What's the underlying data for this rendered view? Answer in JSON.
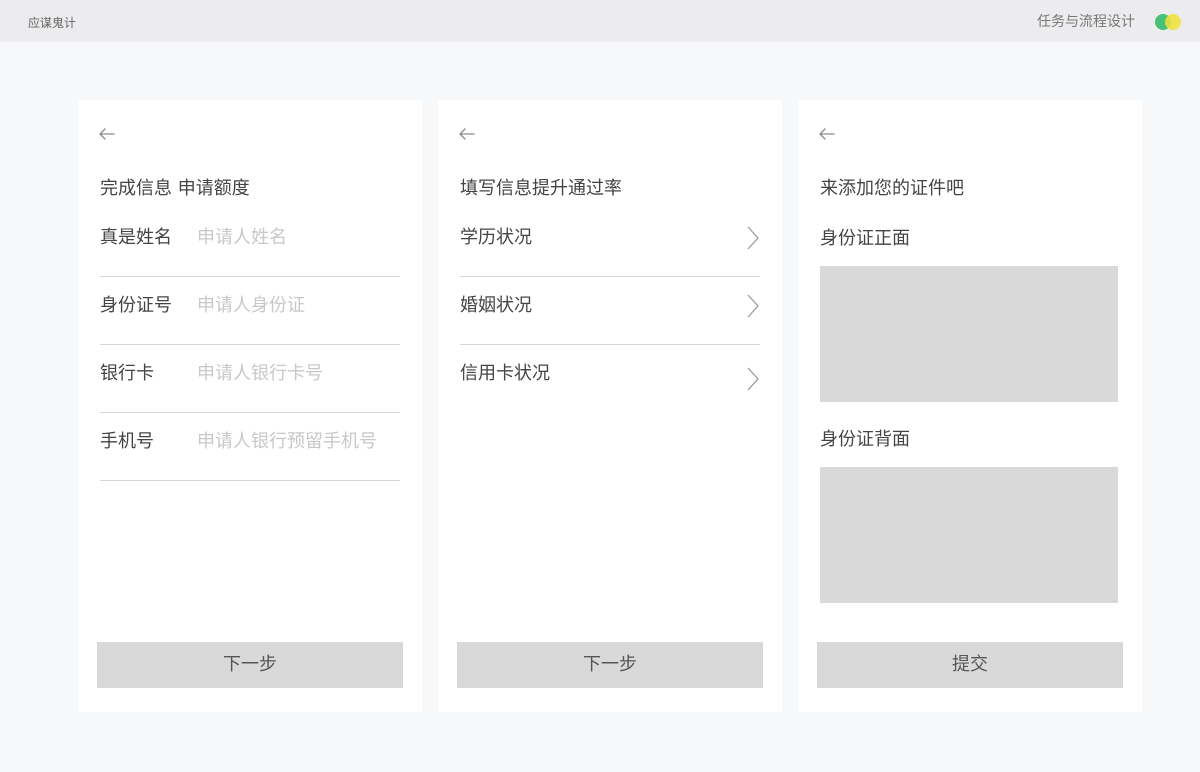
{
  "header": {
    "app_title": "应谋鬼计",
    "section_title": "任务与流程设计",
    "logo_icon": "two-circles-logo-icon",
    "logo_colors": [
      "#3fbf6f",
      "#f3e23a"
    ]
  },
  "screen1": {
    "back_icon": "arrow-left-icon",
    "title": "完成信息 申请额度",
    "fields": [
      {
        "label": "真是姓名",
        "placeholder": "申请人姓名",
        "value": ""
      },
      {
        "label": "身份证号",
        "placeholder": "申请人身份证",
        "value": ""
      },
      {
        "label": "银行卡",
        "placeholder": "申请人银行卡号",
        "value": ""
      },
      {
        "label": "手机号",
        "placeholder": "申请人银行预留手机号",
        "value": ""
      }
    ],
    "next_label": "下一步"
  },
  "screen2": {
    "back_icon": "arrow-left-icon",
    "title": "填写信息提升通过率",
    "items": [
      {
        "label": "学历状况",
        "icon": "chevron-right-icon"
      },
      {
        "label": "婚姻状况",
        "icon": "chevron-right-icon"
      },
      {
        "label": "信用卡状况",
        "icon": "chevron-right-icon"
      }
    ],
    "next_label": "下一步"
  },
  "screen3": {
    "back_icon": "arrow-left-icon",
    "title": "来添加您的证件吧",
    "id_front_label": "身份证正面",
    "id_back_label": "身份证背面",
    "submit_label": "提交"
  }
}
